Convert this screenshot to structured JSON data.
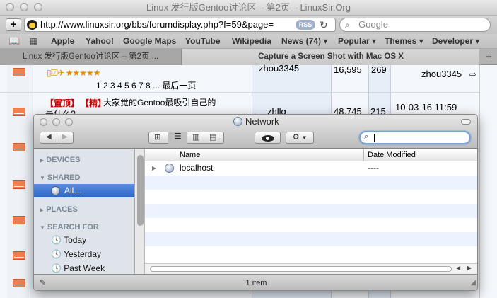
{
  "safari": {
    "window_title": "Linux 发行版Gentoo讨论区 – 第2页 – LinuxSir.Org",
    "address": "http://www.linuxsir.org/bbs/forumdisplay.php?f=59&page=",
    "rss_label": "RSS",
    "search_placeholder": "Google",
    "bookmarks": [
      "Apple",
      "Yahoo!",
      "Google Maps",
      "YouTube",
      "Wikipedia",
      "News (74)",
      "Popular",
      "Themes",
      "Developer"
    ],
    "tabs": [
      {
        "label": "Linux 发行版Gentoo讨论区 – 第2页 ...",
        "active": false
      },
      {
        "label": "Capture a Screen Shot with Mac OS X",
        "active": true
      }
    ],
    "add_tab": "+"
  },
  "forum": {
    "row1": {
      "pages": "1 2 3 4 5 6 7 8 ... 最后一页",
      "author": "zhou3345",
      "views": "16,595",
      "replies": "269",
      "last_post": "zhou3345"
    },
    "row2": {
      "tag1": "【置顶】",
      "tag2": "【精】",
      "title": "大家觉的Gentoo最吸引自己的是什么?",
      "author": "zhllg",
      "views": "48,745",
      "replies": "215",
      "last_post": "10-03-16 11:59"
    }
  },
  "finder": {
    "title": "Network",
    "sidebar": {
      "devices": "DEVICES",
      "shared": "SHARED",
      "shared_item": "All…",
      "places": "PLACES",
      "search_for": "SEARCH FOR",
      "search_items": [
        "Today",
        "Yesterday",
        "Past Week"
      ]
    },
    "columns": {
      "name": "Name",
      "date": "Date Modified"
    },
    "rows": [
      {
        "name": "localhost",
        "date": "----"
      }
    ],
    "status": "1 item"
  },
  "colors": {
    "selection": "#3875d7",
    "envelope": "#f07e4e",
    "sticky_red": "#cc0000"
  }
}
